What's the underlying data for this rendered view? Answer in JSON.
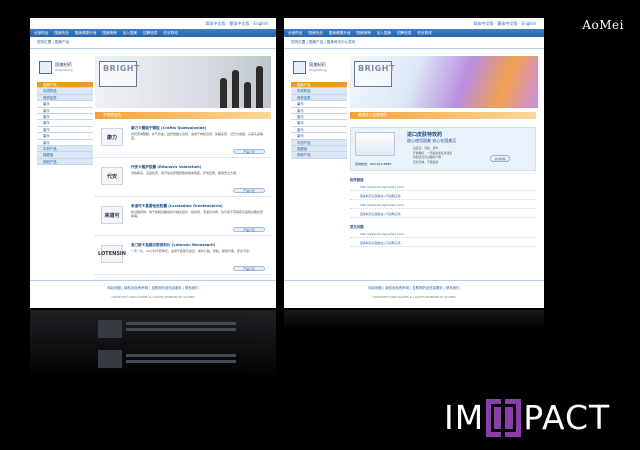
{
  "brand_top": "AoMei",
  "impact": {
    "left": "IM",
    "right": "PACT"
  },
  "left_site": {
    "top_links": [
      "简体中文版",
      "繁体中文版",
      "English"
    ],
    "nav": [
      "全部药品",
      "国美药品",
      "国美健康天地",
      "国美精神",
      "加入国美",
      "招聘信息",
      "驻京联络"
    ],
    "breadcrumb": "您的位置 | 国美产品",
    "logo": "国美制药",
    "logo_sub": "Qiaghetang",
    "banner_text": "BRIGHT",
    "side_menu": [
      {
        "label": "国美产品",
        "kind": "head"
      },
      {
        "label": "中成药品",
        "kind": "group"
      },
      {
        "label": "西药品类",
        "kind": "group"
      },
      {
        "label": "康乐",
        "kind": "item"
      },
      {
        "label": "康乐",
        "kind": "item"
      },
      {
        "label": "康乐",
        "kind": "item"
      },
      {
        "label": "康乐",
        "kind": "item"
      },
      {
        "label": "康乐",
        "kind": "item"
      },
      {
        "label": "康乐",
        "kind": "item"
      },
      {
        "label": "康乐",
        "kind": "item"
      },
      {
        "label": "中药产品",
        "kind": "group"
      },
      {
        "label": "保健品",
        "kind": "group"
      },
      {
        "label": "其他产品",
        "kind": "group"
      }
    ],
    "content_title": "中药精品品",
    "products": [
      {
        "brand": "康力",
        "name": "康力®醒脑宁颗粒 (Craftis Quatoplanide)",
        "desc": "具有安神醒脑、补气养血、益智健脑之功效，适用于神经衰弱、失眠多梦、记忆力减退、头痛头晕等症。",
        "more": "产品介绍"
      },
      {
        "brand": "代安",
        "name": "代安®醒护胶囊 (Ritonavir Valoratum)",
        "desc": "清热解毒、活血化瘀，用于热毒瘀阻所致的各类病症，疗效显著，服用安全方便。",
        "more": "产品介绍"
      },
      {
        "brand": "来道可",
        "name": "来道可®氯雷他定胶囊 (Loratadine Grenteacteria)",
        "desc": "抗过敏药物，用于缓解过敏性鼻炎相关症状，如喷嚏、流涕及鼻痒，也可用于荨麻疹及其他过敏性皮肤病。",
        "more": "产品介绍"
      },
      {
        "brand": "LOTENSIN",
        "name": "洛汀新®盐酸贝那普利片 (Lotensin Benazepril)",
        "desc": "一天一片，24小时平稳降压，适用于各型高血压，保护心脏、肾脏，服用方便，安全可靠。",
        "more": "产品介绍"
      }
    ],
    "footer_links": "网站地图 | 版权及免责声明 | 互联网药品信息服务 | 联系我们",
    "copyright": "COPYRIGHT©2006 QIAOMEI ALL RIGHTS RESERVED BY QIAOMEI"
  },
  "right_site": {
    "top_links": [
      "简体中文版",
      "繁体中文版",
      "English"
    ],
    "nav": [
      "全部药品",
      "国美药品",
      "国美健康天地",
      "国美精神",
      "加入国美",
      "招聘信息",
      "驻京联络"
    ],
    "breadcrumb": "您的位置 | 国美产品 | 国美资讯中心发布",
    "logo": "国美制药",
    "logo_sub": "Qiaghetang",
    "banner_text": "BRIGHT",
    "side_menu": [
      {
        "label": "国美产品",
        "kind": "head"
      },
      {
        "label": "中成药品",
        "kind": "group"
      },
      {
        "label": "西药品类",
        "kind": "group"
      },
      {
        "label": "康乐",
        "kind": "item"
      },
      {
        "label": "康乐",
        "kind": "item"
      },
      {
        "label": "康乐",
        "kind": "item"
      },
      {
        "label": "康乐",
        "kind": "item"
      },
      {
        "label": "康乐",
        "kind": "item"
      },
      {
        "label": "康乐",
        "kind": "item"
      },
      {
        "label": "中药产品",
        "kind": "group"
      },
      {
        "label": "保健品",
        "kind": "group"
      },
      {
        "label": "其他产品",
        "kind": "group"
      }
    ],
    "content_title": "美国进口皮肤用药",
    "feature_title": "进口皮肤特效药",
    "feature_sub": "放心使用国美 安心在国美买",
    "feature_points": [
      "适应证：湿疹、皮炎",
      "疗效确切，一周后患者症状改善",
      "特别适合易过敏的人群",
      "无色无味，不留痕迹"
    ],
    "hotline": "咨询热线：800-810-8888",
    "section1": "相关链接",
    "links1": [
      "http://www.zhongmeilian.com/",
      "国美制药全面推进公司战略实施",
      "http://www.zhongmeilian.com/",
      "国美制药全面推进公司战略实施"
    ],
    "section2": "常见问题",
    "links2": [
      "http://www.zhongmeilian.com/",
      "国美制药全面推进公司战略实施"
    ],
    "chat": "在线客服",
    "footer_links": "网站地图 | 版权及免责声明 | 互联网药品信息服务 | 联系我们",
    "copyright": "COPYRIGHT©2006 QIAOMEI ALL RIGHTS RESERVED BY QIAOMEI"
  }
}
